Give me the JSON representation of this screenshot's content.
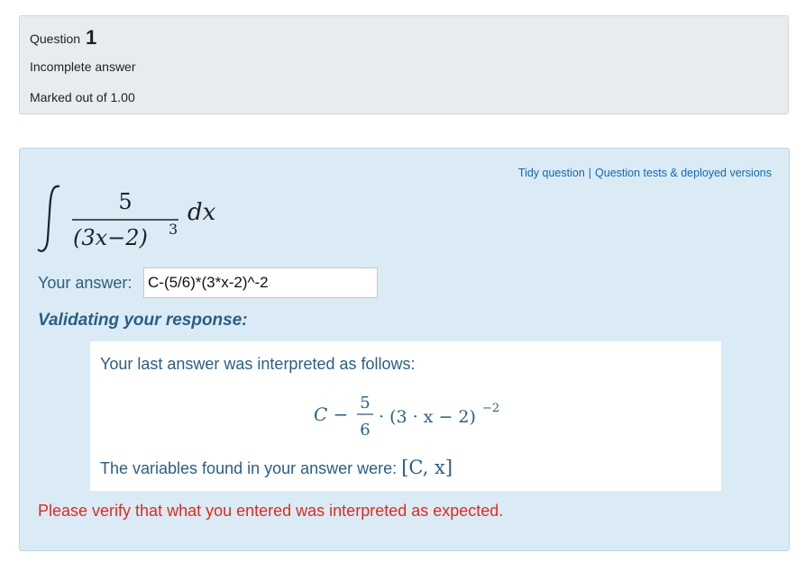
{
  "info": {
    "question_label": "Question",
    "question_number": "1",
    "state": "Incomplete answer",
    "grade": "Marked out of 1.00"
  },
  "links": {
    "tidy": "Tidy question",
    "separator": "|",
    "tests": "Question tests & deployed versions"
  },
  "question_math": {
    "numerator": "5",
    "denominator": "(3x−2)",
    "exponent": "3",
    "differential": "dx"
  },
  "answer": {
    "label": "Your answer:",
    "value": "C-(5/6)*(3*x-2)^-2"
  },
  "validation": {
    "heading": "Validating your response:",
    "interpreted_text": "Your last answer was interpreted as follows:",
    "interpreted_math": {
      "lead": "C −",
      "numerator": "5",
      "denominator": "6",
      "body": "· (3 · x − 2)",
      "exponent": "−2"
    },
    "variables_text": "The variables found in your answer were:",
    "variables_math": "[C, x]"
  },
  "warning": "Please verify that what you entered was interpreted as expected.",
  "colors": {
    "info_bg": "#e9ecef",
    "formulation_bg": "#dbebf5",
    "text_blue": "#2c5e84",
    "link_blue": "#1567b0",
    "warning_red": "#e0291f"
  }
}
